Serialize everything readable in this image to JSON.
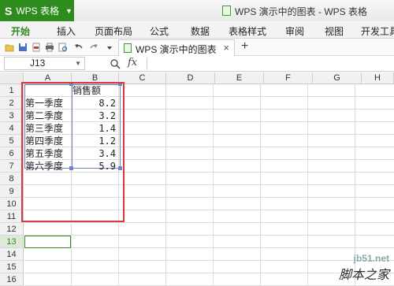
{
  "app": {
    "logo": "S",
    "name": "WPS 表格",
    "title": "WPS 演示中的图表 - WPS 表格"
  },
  "ribbon": {
    "tabs": [
      {
        "label": "开始",
        "active": true
      },
      {
        "label": "插入"
      },
      {
        "label": "页面布局"
      },
      {
        "label": "公式"
      },
      {
        "label": "数据"
      },
      {
        "label": "表格样式"
      },
      {
        "label": "审阅"
      },
      {
        "label": "视图"
      },
      {
        "label": "开发工具"
      }
    ]
  },
  "toolbar": {
    "icons": [
      "open-icon",
      "save-icon",
      "export-pdf-icon",
      "print-icon",
      "print-preview-icon",
      "undo-icon",
      "redo-icon",
      "more-icon"
    ],
    "doc_tab": {
      "label": "WPS 演示中的图表",
      "close": "×"
    },
    "new_tab": "+"
  },
  "formula_bar": {
    "cell_ref": "J13",
    "zoom_symbol": "🔍",
    "fx": "fx",
    "value": ""
  },
  "sheet": {
    "columns": [
      "A",
      "B",
      "C",
      "D",
      "E",
      "F",
      "G",
      "H"
    ],
    "rows": [
      "1",
      "2",
      "3",
      "4",
      "5",
      "6",
      "7",
      "8",
      "9",
      "10",
      "11",
      "12",
      "13",
      "14",
      "15",
      "16"
    ],
    "selected_row": "13",
    "header_b1": "销售额",
    "data": [
      {
        "label": "第一季度",
        "value": "8.2"
      },
      {
        "label": "第二季度",
        "value": "3.2"
      },
      {
        "label": "第三季度",
        "value": "1.4"
      },
      {
        "label": "第四季度",
        "value": "1.2"
      },
      {
        "label": "第五季度",
        "value": "3.4"
      },
      {
        "label": "第六季度",
        "value": "5.9"
      }
    ]
  },
  "watermark": {
    "url": "jb51.net",
    "name": "脚本之家"
  },
  "colors": {
    "accent": "#2e8b1e",
    "highlight_box": "#d9393b",
    "selection": "#6a86c9"
  }
}
